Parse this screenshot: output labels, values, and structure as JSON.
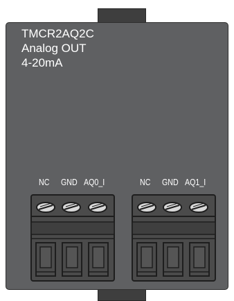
{
  "module": {
    "model": "TMCR2AQ2C",
    "function": "Analog OUT",
    "range": "4-20mA"
  },
  "terminal_blocks": [
    {
      "pins": [
        "NC",
        "GND",
        "AQ0_I"
      ]
    },
    {
      "pins": [
        "NC",
        "GND",
        "AQ1_I"
      ]
    }
  ],
  "colors": {
    "housing": "#5f6062",
    "terminal": "#4b4b4b",
    "text": "#ffffff"
  },
  "icons": [
    "screw-icon",
    "wire-slot-icon"
  ]
}
